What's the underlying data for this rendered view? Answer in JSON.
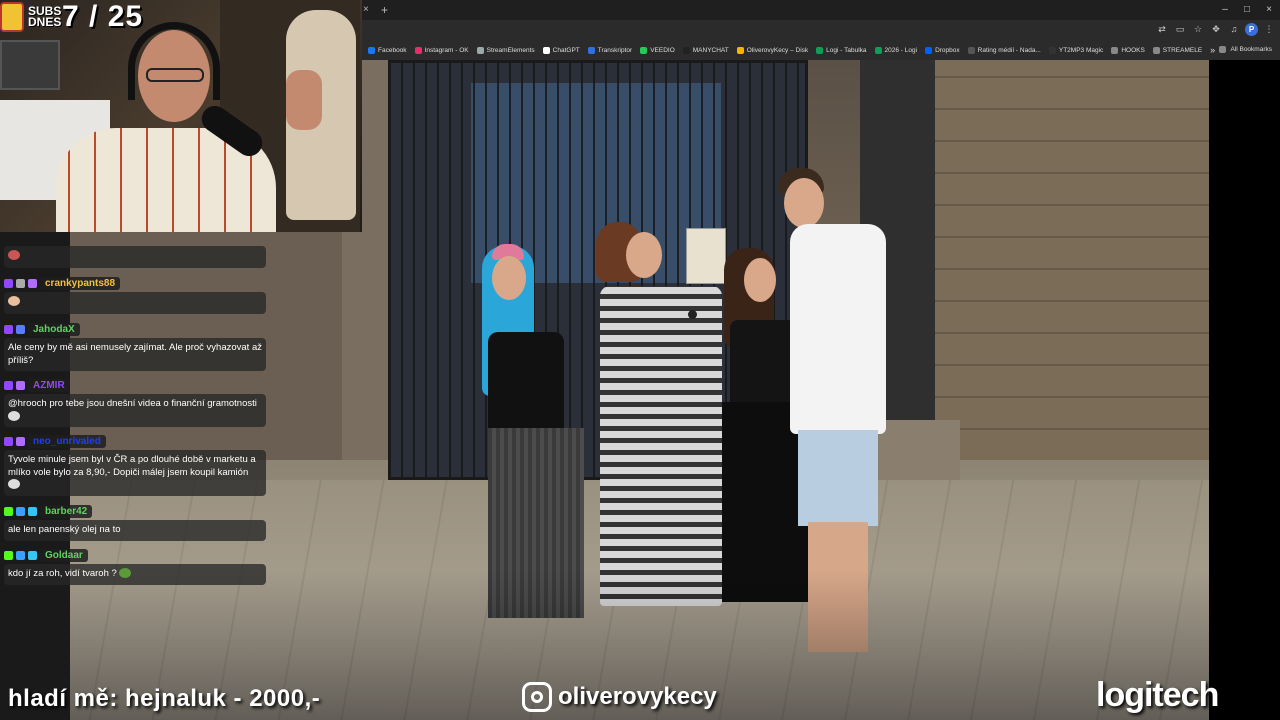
{
  "browser": {
    "tab_close": "×",
    "tab_new": "+",
    "window_controls": [
      "–",
      "□",
      "×"
    ],
    "toolbar_icons": [
      "translate-icon",
      "cast-icon",
      "star-icon",
      "extensions-icon",
      "media-icon",
      "profile-icon",
      "menu-icon"
    ],
    "profile_initial": "P",
    "bookmarks": [
      {
        "label": "Facebook",
        "color": "#1877f2"
      },
      {
        "label": "Instagram - OK",
        "color": "#e1306c"
      },
      {
        "label": "StreamElements",
        "color": "#9aa"
      },
      {
        "label": "ChatGPT",
        "color": "#ffffff"
      },
      {
        "label": "Transkriptor",
        "color": "#2f6fe0"
      },
      {
        "label": "VEEDIO",
        "color": "#22cc55"
      },
      {
        "label": "MANYCHAT",
        "color": "#222222"
      },
      {
        "label": "OliverovyKecy – Disk",
        "color": "#f4b400"
      },
      {
        "label": "Logi - Tabulka",
        "color": "#0f9d58"
      },
      {
        "label": "2026 - Logi",
        "color": "#0f9d58"
      },
      {
        "label": "Dropbox",
        "color": "#0061fe"
      },
      {
        "label": "Rating médií - Nada...",
        "color": "#555"
      },
      {
        "label": "YT2MP3 Magic",
        "color": "#333"
      },
      {
        "label": "HOOKS",
        "color": "#888"
      },
      {
        "label": "STREAMELE",
        "color": "#888"
      }
    ],
    "bookmarks_more": "»",
    "all_bookmarks": "All Bookmarks"
  },
  "overlay": {
    "subs_label": "SUBS DNES",
    "subs_count": "7 / 25"
  },
  "chat": {
    "messages": [
      {
        "user": "",
        "user_color": "#ffffff",
        "text": ""
      },
      {
        "user": "crankypants88",
        "user_color": "#f1c232",
        "text": ""
      },
      {
        "user": "JahodaX",
        "user_color": "#5fd35f",
        "text": "Ale ceny by mě asi nemusely zajímat. Ale proč vyhazovat až příliš?"
      },
      {
        "user": "AZMIR",
        "user_color": "#9146ff",
        "text": "@hrooch pro tebe jsou dnešní videa o finanční gramotnosti"
      },
      {
        "user": "neo_unrivaled",
        "user_color": "#1e3cff",
        "text": "Tyvole minule jsem byl v ČR a po dlouhé době v marketu a mlíko vole bylo za 8,90,- Dopiči málej jsem koupil kamión"
      },
      {
        "user": "barber42",
        "user_color": "#5fd35f",
        "text": "ale len panenský olej na to"
      },
      {
        "user": "Goldaar",
        "user_color": "#5fd35f",
        "text": "kdo jí za roh, vidí tvaroh ?"
      }
    ]
  },
  "bottom": {
    "donation": "hladí mě: hejnaluk - 2000,-",
    "instagram_handle": "oliverovykecy",
    "sponsor": "logitech"
  }
}
